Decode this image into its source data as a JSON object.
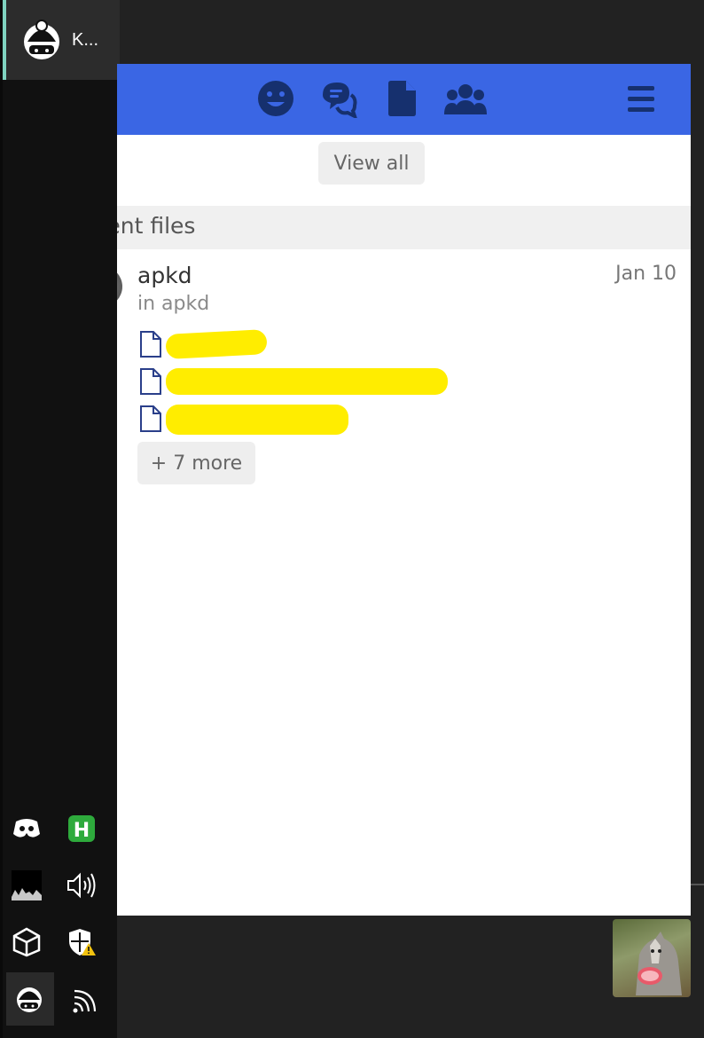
{
  "taskbar": {
    "active_item": {
      "label": "K...",
      "icon": "character-icon"
    },
    "tray": [
      {
        "name": "discord-icon"
      },
      {
        "name": "h-app-icon"
      },
      {
        "name": "performance-graph-icon"
      },
      {
        "name": "volume-icon"
      },
      {
        "name": "unity-icon"
      },
      {
        "name": "security-warning-icon"
      },
      {
        "name": "character-icon"
      },
      {
        "name": "wifi-icon"
      }
    ]
  },
  "header": {
    "icons": [
      "emoji-icon",
      "chat-icon",
      "file-icon",
      "team-icon",
      "menu-icon"
    ],
    "color": "#3a66e4"
  },
  "view_all_label": "View all",
  "section_title": "Recent files",
  "entry": {
    "author": "apkd",
    "date": "Jan 10",
    "location": "in apkd",
    "more_label": "+ 7 more"
  },
  "redaction_color": "#ffed00"
}
